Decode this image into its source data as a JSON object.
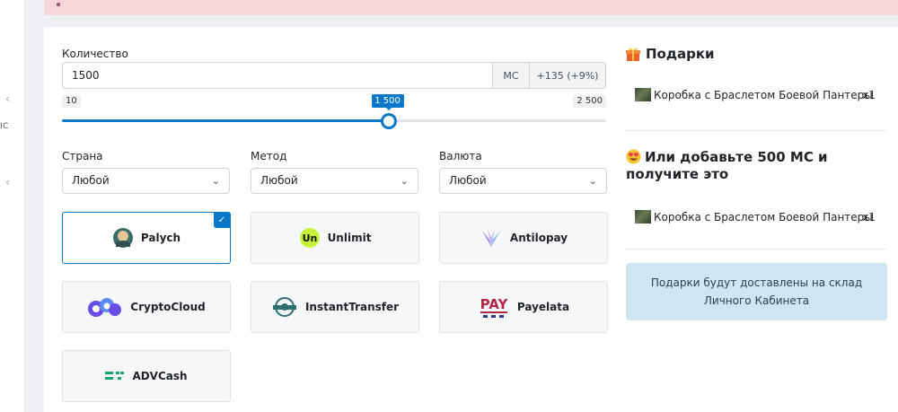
{
  "sidebar": {
    "chevron": "‹",
    "cut_label": "ІС"
  },
  "form": {
    "quantity_label": "Количество",
    "quantity_value": "1500",
    "unit": "МС",
    "bonus": "+135 (+9%)",
    "range_min": "10",
    "range_max": "2 500",
    "range_value": "1 500",
    "range_level_fraction": 0.6
  },
  "filters": {
    "country": {
      "label": "Страна",
      "value": "Любой"
    },
    "method": {
      "label": "Метод",
      "value": "Любой"
    },
    "currency": {
      "label": "Валюта",
      "value": "Любой"
    }
  },
  "methods": [
    {
      "name": "Palych",
      "selected": true,
      "logo": "palych-logo"
    },
    {
      "name": "Unlimit",
      "selected": false,
      "logo": "unlimit-logo"
    },
    {
      "name": "Antilopay",
      "selected": false,
      "logo": "antilopay-logo"
    },
    {
      "name": "CryptoCloud",
      "selected": false,
      "logo": "cryptocloud-logo"
    },
    {
      "name": "InstantTransfer",
      "selected": false,
      "logo": "instanttransfer-logo"
    },
    {
      "name": "Payelata",
      "selected": false,
      "logo": "payelata-logo"
    },
    {
      "name": "ADVCash",
      "selected": false,
      "logo": "advcash-logo"
    }
  ],
  "gifts": {
    "title": "Подарки",
    "title_icon": "gift-icon",
    "item": {
      "name": "Коробка с Браслетом Боевой Пантеры",
      "qty": "x1"
    },
    "upsell_title": "Или добавьте 500 МС и получите это",
    "upsell_icon": "heart-eyes-emoji-icon",
    "upsell_item": {
      "name": "Коробка с Браслетом Боевой Пантеры",
      "qty": "x1"
    },
    "info": "Подарки будут доставлены на склад Личного Кабинета"
  },
  "colors": {
    "accent": "#0a78c8",
    "alert_bg": "#f8d7da",
    "info_bg": "#cfe6f2"
  }
}
